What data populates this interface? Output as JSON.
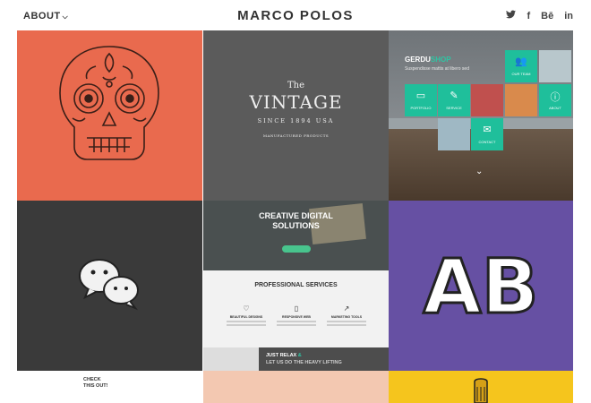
{
  "header": {
    "menu_label": "ABOUT",
    "site_title": "MARCO POLOS",
    "social": [
      {
        "icon": "twitter-icon",
        "glyph": "🐦"
      },
      {
        "icon": "facebook-icon",
        "glyph": "f"
      },
      {
        "icon": "behance-icon",
        "glyph": "Bē"
      },
      {
        "icon": "linkedin-icon",
        "glyph": "in"
      }
    ]
  },
  "tiles": {
    "vintage": {
      "the": "The",
      "vintage": "VINTAGE",
      "since": "SINCE 1894 USA",
      "products": "MANUFACTURED PRODUCTS"
    },
    "team": {
      "brand_a": "GERDU",
      "brand_b": "SHOP",
      "tagline": "Suspendisse mattis at libero sed",
      "our_team": "OUR TEAM",
      "portfolio": "PORTFOLIO",
      "service": "SERVICE",
      "about": "ABOUT",
      "contact": "CONTACT"
    },
    "creative": {
      "title1": "CREATIVE DIGITAL",
      "title2": "SOLUTIONS",
      "services_title": "PROFESSIONAL SERVICES",
      "services": [
        "BEAUTIFUL DESIGNS",
        "RESPONSIVE WEB",
        "MARKETING TOOLS"
      ],
      "relax1": "JUST RELAX",
      "relax1_amp": "&",
      "relax2": "LET US DO THE HEAVY LIFTING"
    },
    "check": {
      "line1": "CHECK",
      "line2": "THIS OUT!"
    },
    "letters": "AB"
  },
  "colors": {
    "accent": "#2fc5a3",
    "orange": "#e96a4e",
    "purple": "#6650a3",
    "yellow": "#f5c51d"
  }
}
